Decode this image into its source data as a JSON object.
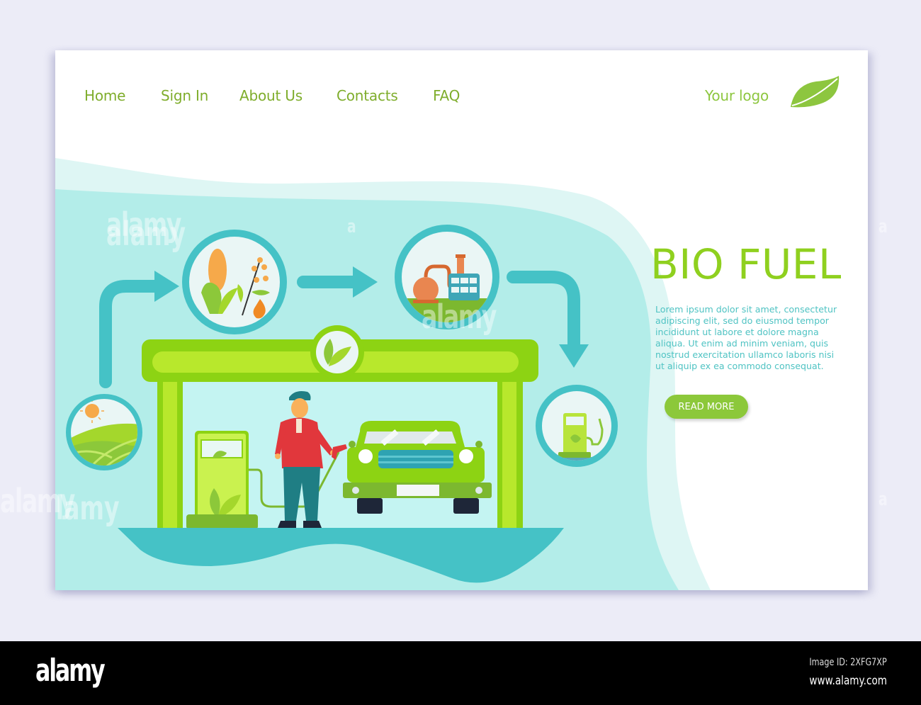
{
  "nav": {
    "items": [
      {
        "label": "Home"
      },
      {
        "label": "Sign In"
      },
      {
        "label": "About Us"
      },
      {
        "label": "Contacts"
      },
      {
        "label": "FAQ"
      }
    ]
  },
  "logo": {
    "text": "Your logo",
    "icon": "leaf-icon"
  },
  "hero": {
    "title": "BIO FUEL",
    "body": "Lorem ipsum dolor sit amet, consectetur adipiscing elit, sed do eiusmod tempor incididunt ut labore et dolore magna aliqua. Ut enim ad minim veniam, quis nostrud exercitation ullamco laboris nisi ut aliquip ex ea commodo consequat.",
    "cta_label": "READ MORE"
  },
  "illustration": {
    "steps": [
      {
        "name": "field",
        "icon": "field-sun-icon"
      },
      {
        "name": "crops",
        "icon": "corn-rapeseed-oil-icon"
      },
      {
        "name": "refinery",
        "icon": "factory-icon"
      },
      {
        "name": "fuel-station",
        "icon": "fuel-pump-icon"
      }
    ],
    "station_sign_icon": "leaf-icon"
  },
  "colors": {
    "accent_green": "#8fd01f",
    "nav_green": "#7fad2c",
    "teal": "#45c2c6",
    "light_teal": "#b3ede9",
    "button_green": "#8cc83a",
    "body_text": "#4fc3c3"
  },
  "watermark": {
    "text": "alamy",
    "short": "a",
    "image_id": "Image ID: 2XFG7XP",
    "url": "www.alamy.com"
  }
}
